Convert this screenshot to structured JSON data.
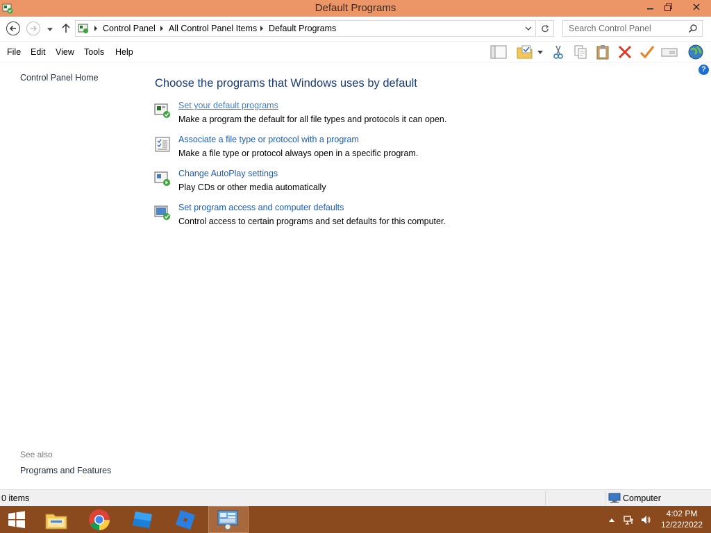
{
  "window": {
    "title": "Default Programs"
  },
  "address": {
    "breadcrumbs": [
      "Control Panel",
      "All Control Panel Items",
      "Default Programs"
    ]
  },
  "search": {
    "placeholder": "Search Control Panel"
  },
  "menu": {
    "items": [
      "File",
      "Edit",
      "View",
      "Tools",
      "Help"
    ]
  },
  "toolbar": {
    "icons": [
      "layout-icon",
      "folder-check-icon",
      "dropdown-icon",
      "cut-icon",
      "copy-icon",
      "paste-icon",
      "delete-icon",
      "properties-icon",
      "rename-icon",
      "globe-icon"
    ]
  },
  "leftpane": {
    "home": "Control Panel Home",
    "see_also": "See also",
    "see_also_links": [
      "Programs and Features"
    ]
  },
  "main": {
    "heading": "Choose the programs that Windows uses by default",
    "tasks": [
      {
        "link": "Set your default programs",
        "desc": "Make a program the default for all file types and protocols it can open.",
        "icon": "default-programs-icon"
      },
      {
        "link": "Associate a file type or protocol with a program",
        "desc": "Make a file type or protocol always open in a specific program.",
        "icon": "file-association-icon"
      },
      {
        "link": "Change AutoPlay settings",
        "desc": "Play CDs or other media automatically",
        "icon": "autoplay-icon"
      },
      {
        "link": "Set program access and computer defaults",
        "desc": "Control access to certain programs and set defaults for this computer.",
        "icon": "program-access-icon"
      }
    ]
  },
  "status": {
    "items": "0 items",
    "zone": "Computer"
  },
  "taskbar": {
    "apps": [
      "start-icon",
      "file-explorer-icon",
      "chrome-icon",
      "roblox-studio-icon",
      "roblox-icon",
      "control-panel-icon"
    ],
    "time": "4:02 PM",
    "date": "12/22/2022"
  },
  "colors": {
    "titlebar": "#ec9667",
    "taskbar": "#8a4a1e",
    "link": "#1e5bb7",
    "heading": "#1a3a78"
  }
}
